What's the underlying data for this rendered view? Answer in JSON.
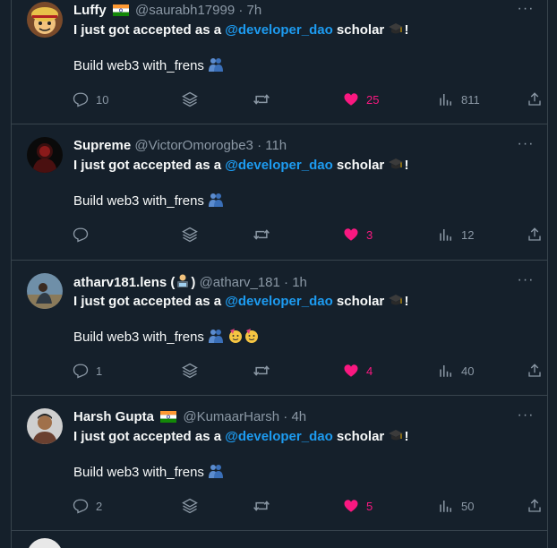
{
  "colors": {
    "background": "#15202b",
    "text": "#f7f9f9",
    "muted": "#8b98a5",
    "mention": "#1d9bf0",
    "like": "#f91880",
    "border": "#38444d"
  },
  "tweets": [
    {
      "name": "Luffy",
      "flag": "india-flag",
      "handle": "@saurabh17999",
      "sep": "·",
      "time": "7h",
      "text_prefix": "I just got accepted as a",
      "mention": "@developer_dao",
      "text_suffix": "scholar",
      "line1_end": "!",
      "line2": "Build web3 with_frens",
      "stats": {
        "replies": "10",
        "likes": "25",
        "views": "811",
        "retweets": ""
      }
    },
    {
      "name": "Supreme",
      "handle": "@VictorOmorogbe3",
      "sep": "·",
      "time": "11h",
      "text_prefix": "I just got accepted as a",
      "mention": "@developer_dao",
      "text_suffix": "scholar",
      "line1_end": "!",
      "line2": "Build web3 with_frens",
      "stats": {
        "replies": "",
        "likes": "3",
        "views": "12",
        "retweets": ""
      }
    },
    {
      "name": "atharv181.lens (",
      "name_end": ")",
      "handle": "@atharv_181",
      "sep": "·",
      "time": "1h",
      "text_prefix": "I just got accepted as a",
      "mention": "@developer_dao",
      "text_suffix": "scholar",
      "line1_end": "!",
      "line2": "Build web3 with_frens",
      "stats": {
        "replies": "1",
        "likes": "4",
        "views": "40",
        "retweets": ""
      }
    },
    {
      "name": "Harsh Gupta",
      "flag": "india-flag",
      "handle": "@KumaarHarsh",
      "sep": "·",
      "time": "4h",
      "text_prefix": "I just got accepted as a",
      "mention": "@developer_dao",
      "text_suffix": "scholar",
      "line1_end": "!",
      "line2": "Build web3 with_frens",
      "stats": {
        "replies": "2",
        "likes": "5",
        "views": "50",
        "retweets": ""
      }
    }
  ],
  "icons": [
    "reply-icon",
    "stack-icon",
    "retweet-icon",
    "heart-icon",
    "views-icon",
    "share-icon",
    "more-icon",
    "graduation-cap-emoji",
    "people-hugging-emoji",
    "partying-face-emoji",
    "technologist-emoji"
  ]
}
